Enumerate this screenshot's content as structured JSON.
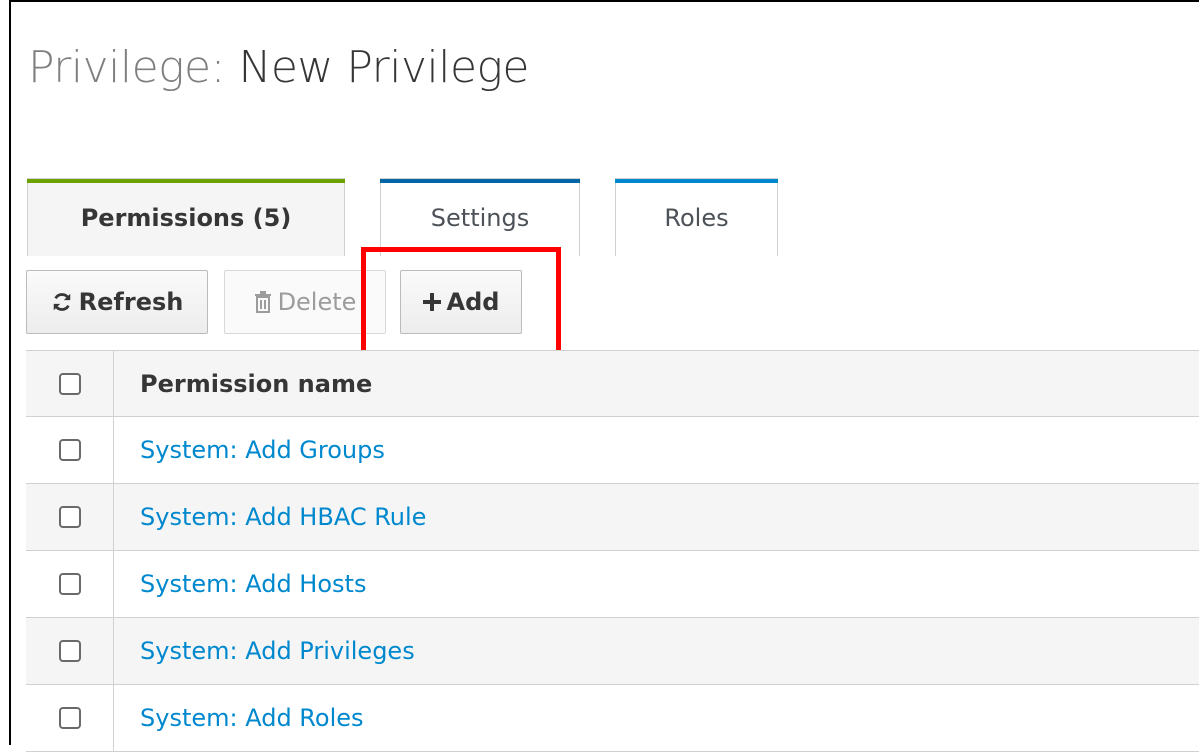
{
  "page": {
    "title_prefix": "Privilege:",
    "title_name": "New Privilege"
  },
  "tabs": [
    {
      "label": "Permissions (5)",
      "active": true,
      "accent_color": "#6ca100"
    },
    {
      "label": "Settings",
      "active": false,
      "accent_color": "#0066a6"
    },
    {
      "label": "Roles",
      "active": false,
      "accent_color": "#0088ce"
    }
  ],
  "toolbar": {
    "refresh_label": "Refresh",
    "refresh_icon": "refresh-icon",
    "delete_label": "Delete",
    "delete_icon": "trash-icon",
    "add_label": "Add",
    "add_icon": "plus-icon"
  },
  "highlight": {
    "target": "add-button",
    "color": "#ff0000"
  },
  "table": {
    "columns": [
      "Permission name"
    ],
    "rows": [
      {
        "name": "System: Add Groups"
      },
      {
        "name": "System: Add HBAC Rule"
      },
      {
        "name": "System: Add Hosts"
      },
      {
        "name": "System: Add Privileges"
      },
      {
        "name": "System: Add Roles"
      }
    ]
  },
  "colors": {
    "link": "#0088ce",
    "row_alt_bg": "#f5f5f5"
  }
}
